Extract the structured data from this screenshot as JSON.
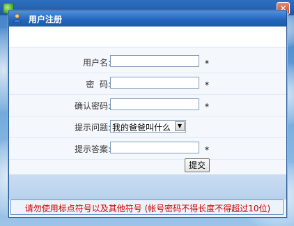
{
  "background_window": {
    "title": "",
    "close_glyph": "✕"
  },
  "dialog": {
    "title": "用户注册",
    "icon": "user-register-icon"
  },
  "form": {
    "fields": [
      {
        "label": "用户名:",
        "value": "",
        "required_mark": "*"
      },
      {
        "label": "密  码:",
        "value": "",
        "required_mark": "*"
      },
      {
        "label": "确认密码:",
        "value": "",
        "required_mark": "*"
      }
    ],
    "question": {
      "label": "提示问题:",
      "selected": "我的爸爸叫什么",
      "arrow_glyph": "▼"
    },
    "answer": {
      "label": "提示答案:",
      "value": "",
      "required_mark": "*"
    },
    "submit_label": "提交"
  },
  "notice": {
    "text": "请勿使用标点符号以及其他符号 (帐号密码不得长度不得超过10位)",
    "color": "#d10000"
  }
}
